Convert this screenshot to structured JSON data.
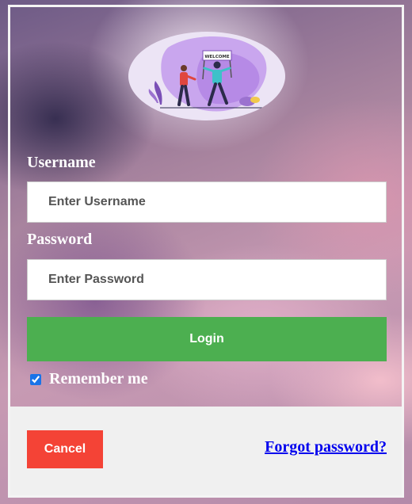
{
  "illustration": {
    "banner_text": "WELCOME"
  },
  "form": {
    "username_label": "Username",
    "username_placeholder": "Enter Username",
    "password_label": "Password",
    "password_placeholder": "Enter Password",
    "login_label": "Login",
    "remember_label": "Remember me",
    "remember_checked": true
  },
  "footer": {
    "cancel_label": "Cancel",
    "forgot_label": "Forgot password?"
  },
  "colors": {
    "login_green": "#4caf50",
    "cancel_red": "#f44336",
    "link_blue": "#0000ee",
    "footer_bg": "#f0f0f0"
  }
}
